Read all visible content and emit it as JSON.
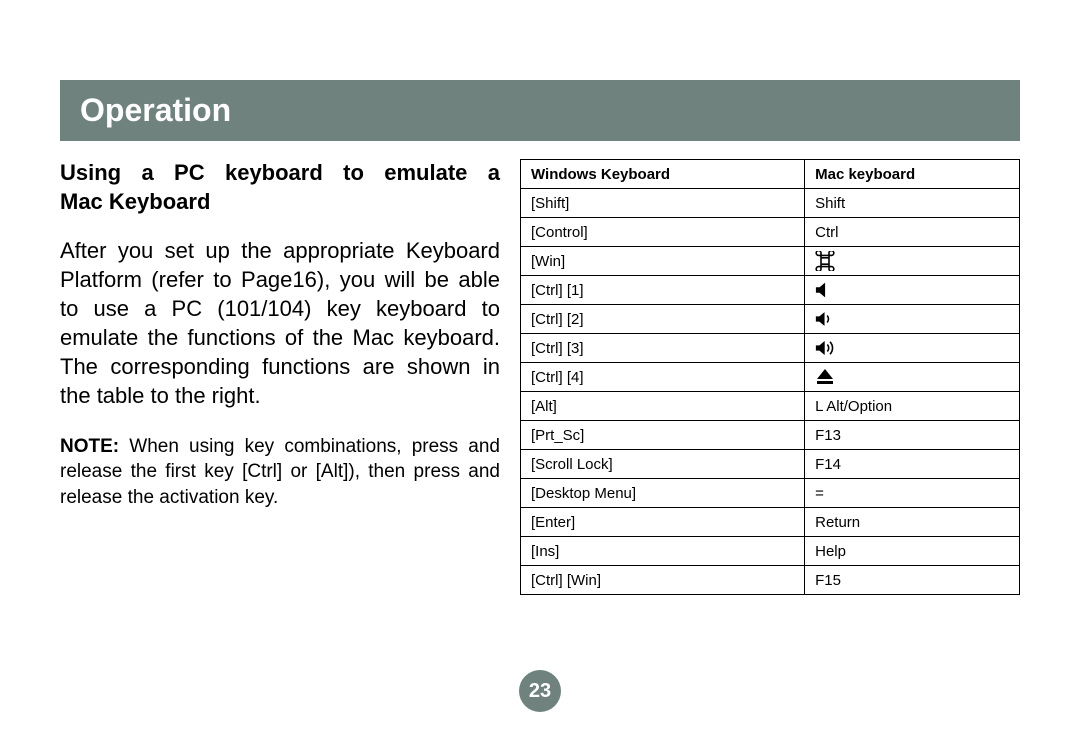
{
  "title_bar": "Operation",
  "heading_line1": "Using a PC keyboard to emulate a",
  "heading_line2": "Mac Keyboard",
  "body_paragraph": "After you set up the appropriate Keyboard Platform (refer to Page16), you will be able to use a PC (101/104) key keyboard to emulate the functions of the Mac keyboard. The corresponding functions are shown in the table to the right.",
  "note_label": "NOTE:",
  "note_body": " When using key combinations, press and release the first key [Ctrl] or [Alt]), then press and release the activation key.",
  "table": {
    "header_left": "Windows Keyboard",
    "header_right": "Mac keyboard",
    "rows": [
      {
        "win": "[Shift]",
        "mac": "Shift",
        "icon": null
      },
      {
        "win": "[Control]",
        "mac": "Ctrl",
        "icon": null
      },
      {
        "win": "[Win]",
        "mac": "",
        "icon": "command"
      },
      {
        "win": "[Ctrl] [1]",
        "mac": "",
        "icon": "mute"
      },
      {
        "win": "[Ctrl] [2]",
        "mac": "",
        "icon": "vol-down"
      },
      {
        "win": "[Ctrl] [3]",
        "mac": "",
        "icon": "vol-up"
      },
      {
        "win": "[Ctrl] [4]",
        "mac": "",
        "icon": "eject"
      },
      {
        "win": "[Alt]",
        "mac": "L Alt/Option",
        "icon": null
      },
      {
        "win": "[Prt_Sc]",
        "mac": "F13",
        "icon": null
      },
      {
        "win": "[Scroll Lock]",
        "mac": "F14",
        "icon": null
      },
      {
        "win": "[Desktop Menu]",
        "mac": "=",
        "icon": null
      },
      {
        "win": "[Enter]",
        "mac": "Return",
        "icon": null
      },
      {
        "win": "[Ins]",
        "mac": "Help",
        "icon": null
      },
      {
        "win": "[Ctrl] [Win]",
        "mac": "F15",
        "icon": null
      }
    ]
  },
  "page_number": "23"
}
